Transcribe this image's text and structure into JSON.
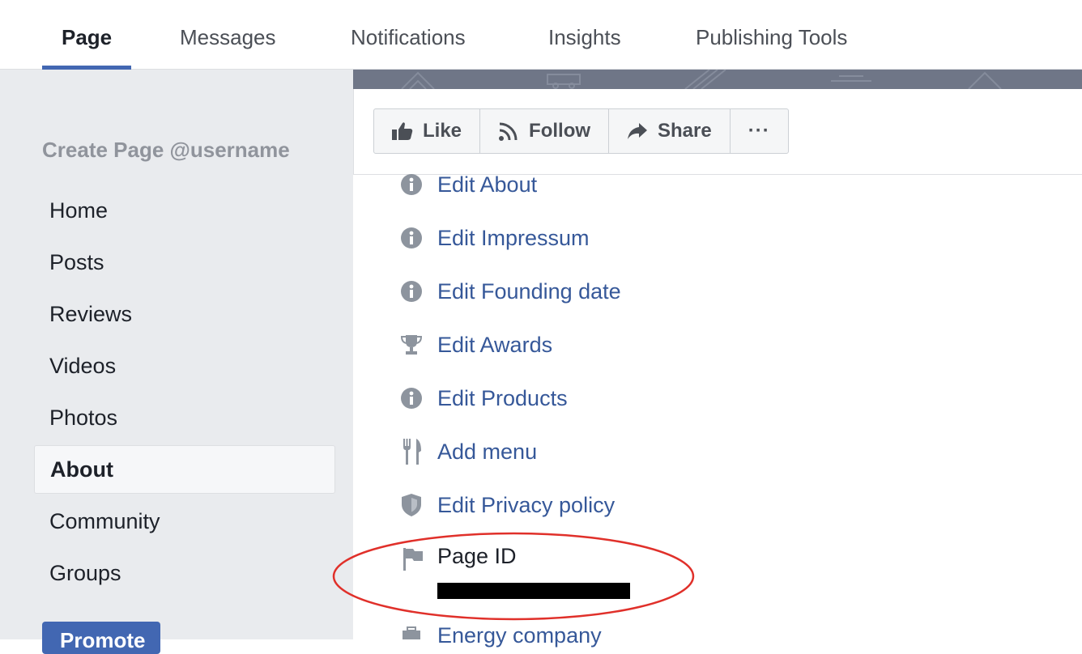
{
  "tabs": [
    {
      "label": "Page",
      "active": true
    },
    {
      "label": "Messages"
    },
    {
      "label": "Notifications"
    },
    {
      "label": "Insights"
    },
    {
      "label": "Publishing Tools"
    }
  ],
  "sidebar": {
    "create_page": "Create Page @username",
    "items": [
      {
        "label": "Home"
      },
      {
        "label": "Posts"
      },
      {
        "label": "Reviews"
      },
      {
        "label": "Videos"
      },
      {
        "label": "Photos"
      },
      {
        "label": "About",
        "active": true
      },
      {
        "label": "Community"
      },
      {
        "label": "Groups"
      }
    ],
    "promote_label": "Promote"
  },
  "actions": {
    "like": "Like",
    "follow": "Follow",
    "share": "Share",
    "more": "···"
  },
  "about_rows": [
    {
      "icon": "info-icon",
      "label": "Edit About"
    },
    {
      "icon": "info-icon",
      "label": "Edit Impressum"
    },
    {
      "icon": "info-icon",
      "label": "Edit Founding date"
    },
    {
      "icon": "trophy-icon",
      "label": "Edit Awards"
    },
    {
      "icon": "info-icon",
      "label": "Edit Products"
    },
    {
      "icon": "fork-knife-icon",
      "label": "Add menu"
    },
    {
      "icon": "shield-icon",
      "label": "Edit Privacy policy"
    }
  ],
  "page_id": {
    "label": "Page ID",
    "value_redacted": true
  },
  "category": "Energy company",
  "colors": {
    "accent": "#4267b2",
    "link": "#365899",
    "sidebar_bg": "#e9ebee",
    "annotation": "#e0302a"
  }
}
